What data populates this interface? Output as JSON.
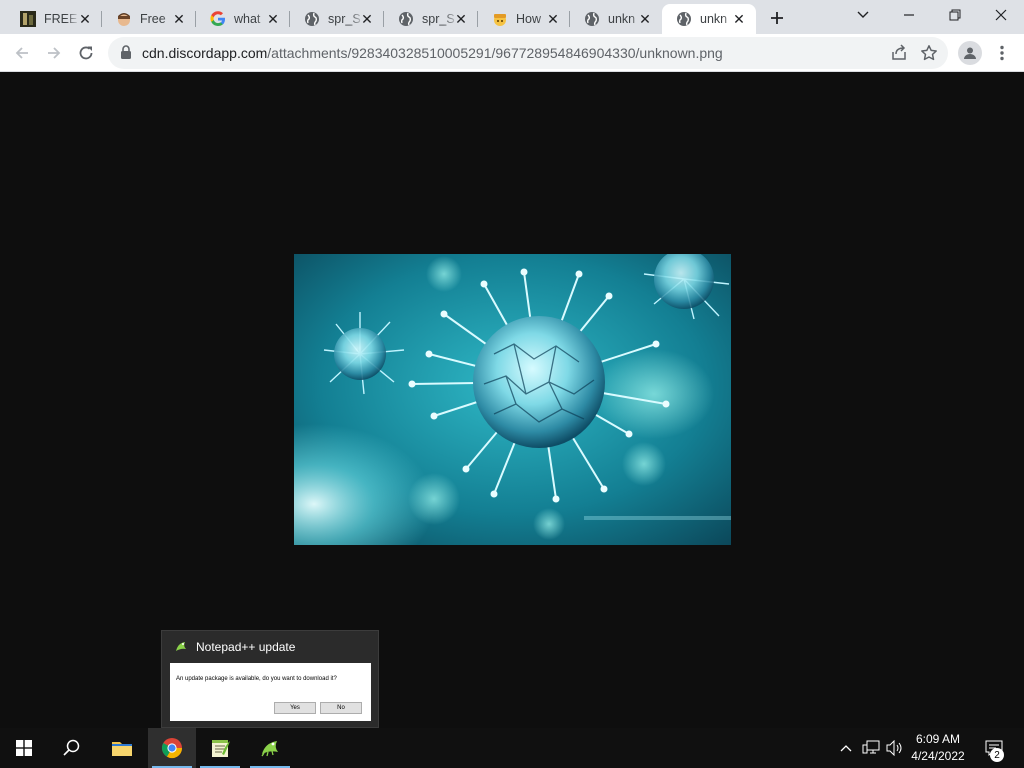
{
  "browser": {
    "tabs": [
      {
        "title": "FREE",
        "icon": "game-favicon"
      },
      {
        "title": "Free",
        "icon": "avatar-favicon"
      },
      {
        "title": "what",
        "icon": "google-favicon"
      },
      {
        "title": "spr_S",
        "icon": "globe-favicon"
      },
      {
        "title": "spr_S",
        "icon": "globe-favicon"
      },
      {
        "title": "How",
        "icon": "emoji-favicon"
      },
      {
        "title": "unkn",
        "icon": "globe-favicon"
      },
      {
        "title": "unkn",
        "icon": "globe-favicon",
        "active": true
      }
    ],
    "url": {
      "host": "cdn.discordapp.com",
      "path": "/attachments/928340328510005291/967728954846904330/unknown.png"
    }
  },
  "notification": {
    "app_name": "Notepad++ update",
    "message": "An update package is available, do you want to download it?",
    "yes_label": "Yes",
    "no_label": "No"
  },
  "taskbar": {
    "apps": [
      "windows-start",
      "search",
      "file-explorer",
      "chrome",
      "notepad-plus-plus-editor",
      "notepad-plus-plus-updater"
    ],
    "time": "6:09 AM",
    "date": "4/24/2022",
    "notification_count": "2"
  },
  "colors": {
    "tabstrip": "#dee1e6",
    "omnibox": "#f1f3f4",
    "page_bg": "#0e0e0e",
    "taskbar": "#101010",
    "accent": "#76b9ed"
  }
}
